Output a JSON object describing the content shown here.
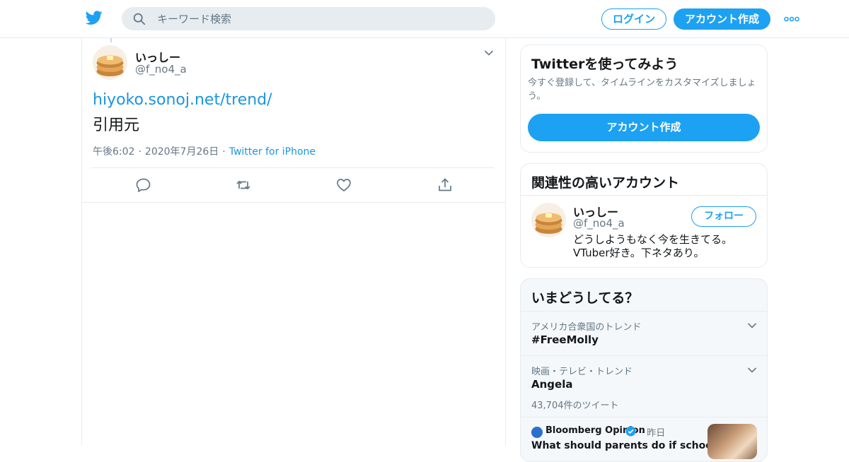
{
  "header": {
    "search_placeholder": "キーワード検索",
    "login_label": "ログイン",
    "signup_label": "アカウント作成",
    "brand_color": "#1da1f2"
  },
  "tweet": {
    "name": "いっしー",
    "handle": "@f_no4_a",
    "link": "hiyoko.sonoj.net/trend/",
    "body": "引用元",
    "time": "午後6:02",
    "date": "2020年7月26日",
    "source": "Twitter for iPhone",
    "actions": [
      "reply-icon",
      "retweet-icon",
      "like-icon",
      "share-icon"
    ]
  },
  "signup_card": {
    "title": "Twitterを使ってみよう",
    "subtitle": "今すぐ登録して、タイムラインをカスタマイズしましょう。",
    "button": "アカウント作成"
  },
  "related": {
    "title": "関連性の高いアカウント",
    "name": "いっしー",
    "handle": "@f_no4_a",
    "follow_label": "フォロー",
    "bio_line1": "どうしようもなく今を生きてる。",
    "bio_line2": "VTuber好き。下ネタあり。"
  },
  "trends": {
    "title": "いまどうしてる？",
    "items": [
      {
        "context": "アメリカ合衆国のトレンド",
        "name": "#FreeMolly"
      },
      {
        "context": "映画・テレビ・トレンド",
        "name": "Angela",
        "count": "43,704件のツイート"
      }
    ],
    "news": {
      "source": "Bloomberg Opinion",
      "time": "昨日",
      "headline": "What should parents do if schools"
    }
  }
}
